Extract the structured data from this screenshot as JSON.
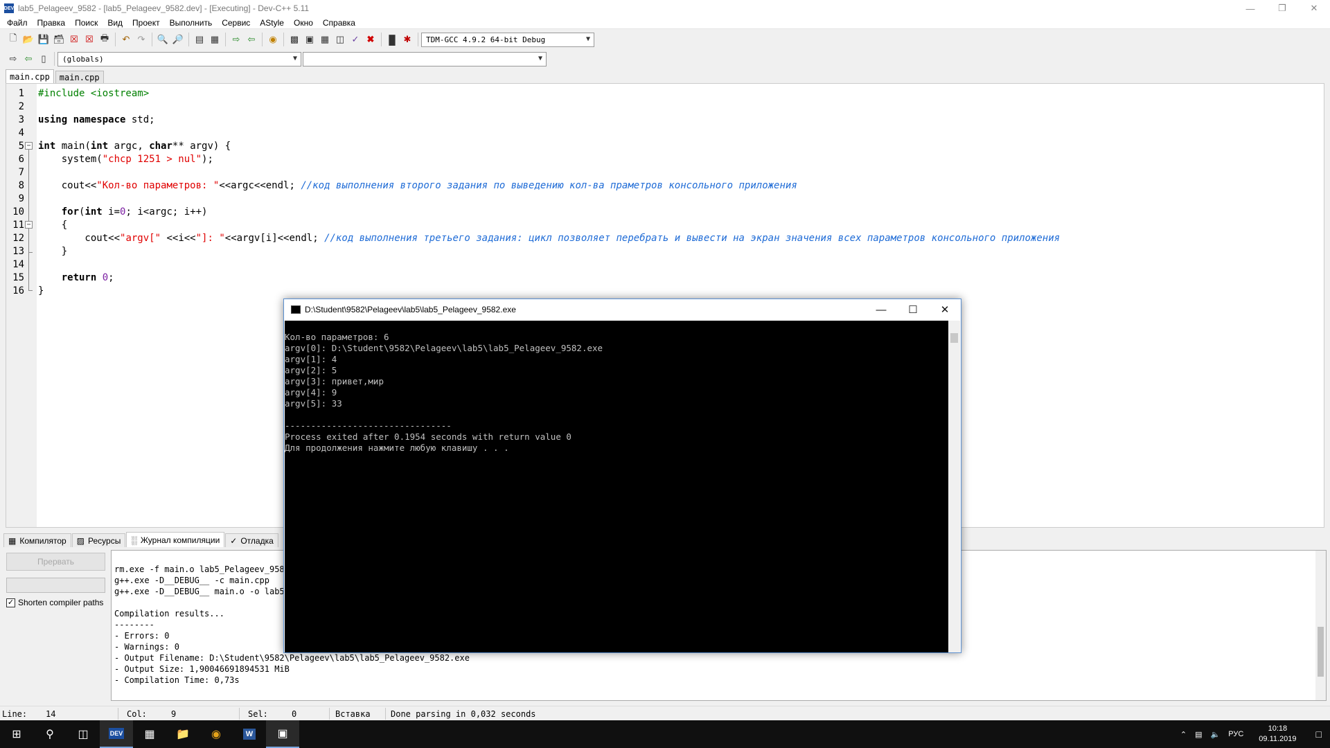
{
  "window": {
    "title": "lab5_Pelageev_9582 - [lab5_Pelageev_9582.dev] - [Executing] - Dev-C++ 5.11",
    "icon_label": "DEV"
  },
  "menu": [
    "Файл",
    "Правка",
    "Поиск",
    "Вид",
    "Проект",
    "Выполнить",
    "Сервис",
    "AStyle",
    "Окно",
    "Справка"
  ],
  "toolbar": {
    "compiler_select": "TDM-GCC 4.9.2 64-bit Debug",
    "scope_select": "(globals)",
    "function_select": ""
  },
  "editor": {
    "tabs": [
      "main.cpp",
      "main.cpp"
    ],
    "line_numbers": [
      "1",
      "2",
      "3",
      "4",
      "5",
      "6",
      "7",
      "8",
      "9",
      "10",
      "11",
      "12",
      "13",
      "14",
      "15",
      "16"
    ]
  },
  "code": {
    "l1": "#include <iostream>",
    "l3_kw": "using namespace",
    "l3_rest": " std;",
    "l5_int1": "int",
    "l5_main": " main(",
    "l5_int2": "int",
    "l5_argc": " argc, ",
    "l5_char": "char",
    "l5_rest": "** argv) {",
    "l6_a": "    system(",
    "l6_str": "\"chcp 1251 > nul\"",
    "l6_b": ");",
    "l8_a": "    cout<<",
    "l8_str": "\"Кол-во параметров: \"",
    "l8_b": "<<argc<<endl; ",
    "l8_cmt": "//код выполнения второго задания по выведению кол-ва праметров консольного приложения",
    "l10_for": "    for",
    "l10_a": "(",
    "l10_int": "int",
    "l10_b": " i=",
    "l10_zero": "0",
    "l10_c": "; i<argc; i++)",
    "l11": "    {",
    "l12_a": "        cout<<",
    "l12_s1": "\"argv[\"",
    "l12_b": " <<i<<",
    "l12_s2": "\"]: \"",
    "l12_c": "<<argv[i]<<endl; ",
    "l12_cmt": "//код выполнения третьего задания: цикл позволяет перебрать и вывести на экран значения всех параметров консольного приложения",
    "l13": "    }",
    "l15_ret": "    return ",
    "l15_zero": "0",
    "l15_semi": ";",
    "l16": "}"
  },
  "bottom_tabs": [
    "Компилятор",
    "Ресурсы",
    "Журнал компиляции",
    "Отладка"
  ],
  "compile_panel": {
    "abort_label": "Прервать",
    "shorten_label": "Shorten compiler paths",
    "shorten_checked": true
  },
  "compile_log": [
    "rm.exe -f main.o lab5_Pelageev_9582.exe",
    "g++.exe -D__DEBUG__ -c main.cpp",
    "g++.exe -D__DEBUG__ main.o -o lab5_Pelageev_9582.exe",
    "",
    "Compilation results...",
    "--------",
    "- Errors: 0",
    "- Warnings: 0",
    "- Output Filename: D:\\Student\\9582\\Pelageev\\lab5\\lab5_Pelageev_9582.exe",
    "- Output Size: 1,90046691894531 MiB",
    "- Compilation Time: 0,73s"
  ],
  "status": {
    "line_label": "Line:",
    "line": "14",
    "col_label": "Col:",
    "col": "9",
    "sel_label": "Sel:",
    "sel": "0",
    "mode": "Вставка",
    "message": "Done parsing in 0,032 seconds"
  },
  "console": {
    "title": "D:\\Student\\9582\\Pelageev\\lab5\\lab5_Pelageev_9582.exe",
    "lines": [
      "Кол-во параметров: 6",
      "argv[0]: D:\\Student\\9582\\Pelageev\\lab5\\lab5_Pelageev_9582.exe",
      "argv[1]: 4",
      "argv[2]: 5",
      "argv[3]: привет,мир",
      "argv[4]: 9",
      "argv[5]: 33",
      "",
      "--------------------------------",
      "Process exited after 0.1954 seconds with return value 0",
      "Для продолжения нажмите любую клавишу . . ."
    ]
  },
  "taskbar": {
    "language": "РУС",
    "time": "10:18",
    "date": "09.11.2019",
    "dev_label": "DEV",
    "word_label": "W"
  }
}
